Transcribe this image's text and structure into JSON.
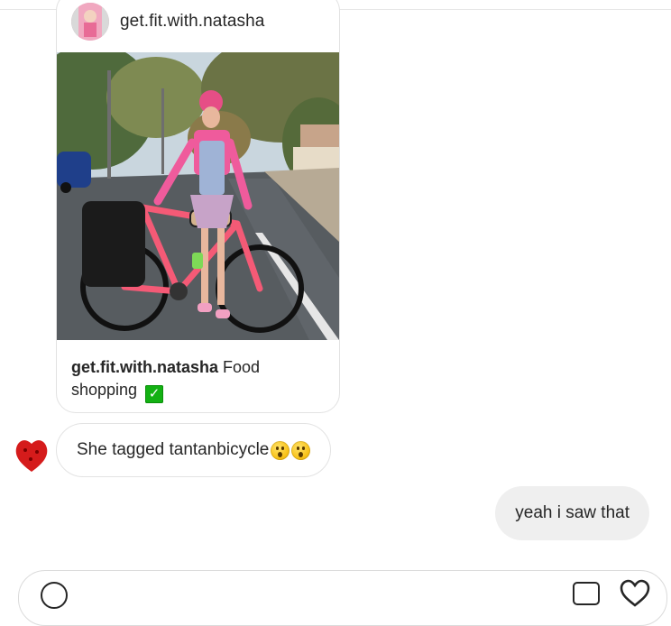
{
  "post": {
    "username": "get.fit.with.natasha",
    "caption_user": "get.fit.with.natasha",
    "caption_text": "Food shopping",
    "caption_emoji": "✅"
  },
  "messages": {
    "incoming_text": "She tagged tantanbicycle",
    "outgoing_text": "yeah i saw that"
  },
  "icons": {
    "composer_left": "emoji-icon",
    "composer_media": "image-icon",
    "composer_like": "heart-icon"
  },
  "colors": {
    "bubble_outgoing": "#efefef",
    "border": "#e3e3e3",
    "text": "#262626"
  }
}
